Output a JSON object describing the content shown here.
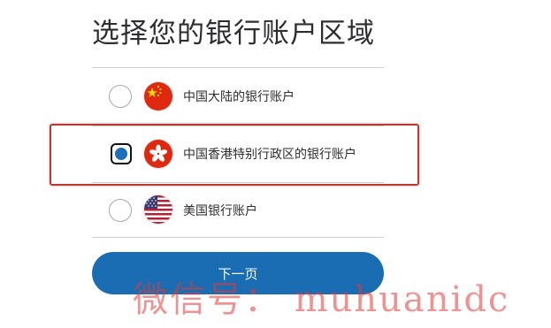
{
  "page": {
    "title": "选择您的银行账户区域"
  },
  "options": [
    {
      "label": "中国大陆的银行账户",
      "flag": "china-flag-icon",
      "selected": false
    },
    {
      "label": "中国香港特别行政区的银行账户",
      "flag": "hong-kong-flag-icon",
      "selected": true
    },
    {
      "label": "美国银行账户",
      "flag": "usa-flag-icon",
      "selected": false
    }
  ],
  "actions": {
    "next_label": "下一页"
  },
  "watermark": {
    "text": "微信号： muhuanidc"
  },
  "colors": {
    "primary": "#1a6db3",
    "selection_border": "#b93a32",
    "watermark": "#e03a3a"
  }
}
